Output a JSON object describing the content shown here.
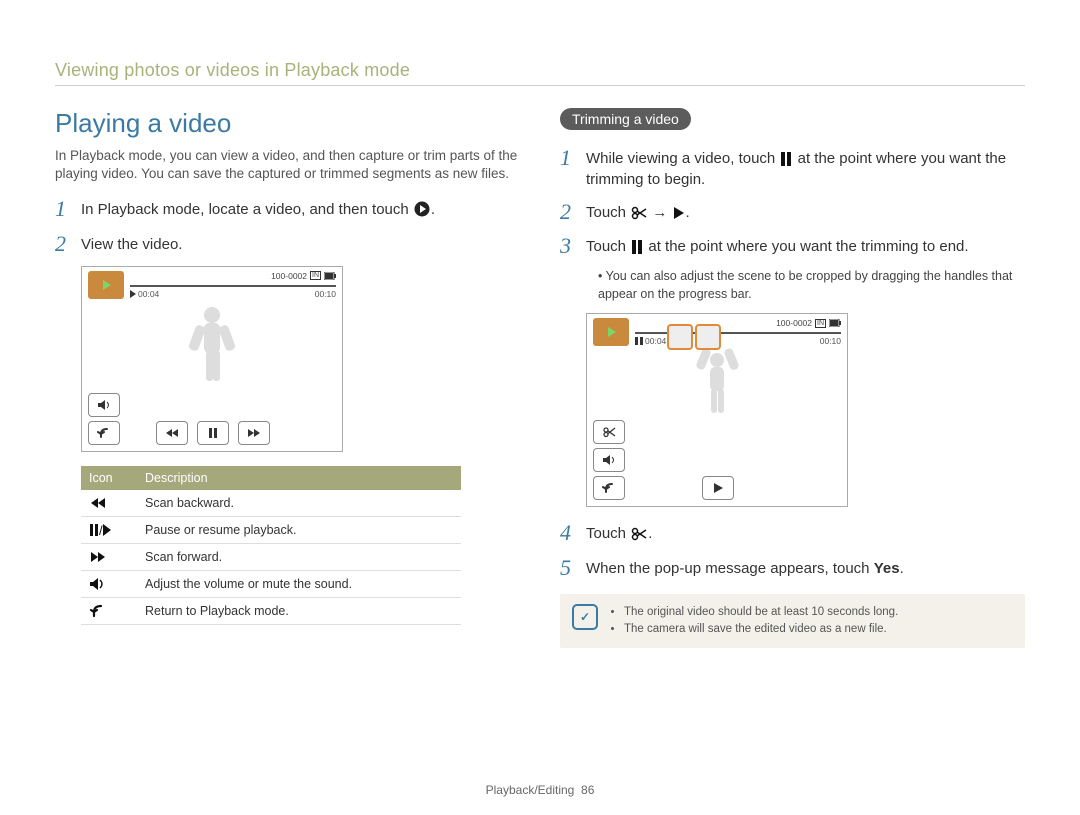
{
  "breadcrumb": "Viewing photos or videos in Playback mode",
  "section_title": "Playing a video",
  "intro": "In Playback mode, you can view a video, and then capture or trim parts of the playing video. You can save the captured or trimmed segments as new files.",
  "left_steps": {
    "s1_a": "In Playback mode, locate a video, and then touch ",
    "s1_b": ".",
    "s2": "View the video."
  },
  "shot1": {
    "elapsed": "00:04",
    "total": "00:10",
    "file_no": "100-0002",
    "mem": "IN"
  },
  "table": {
    "head_icon": "Icon",
    "head_desc": "Description",
    "r1": "Scan backward.",
    "r2": "Pause or resume playback.",
    "r3": "Scan forward.",
    "r4": "Adjust the volume or mute the sound.",
    "r5": "Return to Playback mode."
  },
  "pill": "Trimming a video",
  "right_steps": {
    "s1_a": "While viewing a video, touch ",
    "s1_b": " at the point where you want the trimming to begin.",
    "s2_a": "Touch ",
    "s2_b": " → ",
    "s2_c": ".",
    "s3_a": "Touch ",
    "s3_b": " at the point where you want the trimming to end.",
    "s3_note": "You can also adjust the scene to be cropped by dragging the handles that appear on the progress bar.",
    "s4_a": "Touch ",
    "s4_b": ".",
    "s5_a": "When the pop-up message appears, touch ",
    "s5_yes": "Yes",
    "s5_b": "."
  },
  "shot2": {
    "elapsed": "00:04",
    "total": "00:10",
    "file_no": "100-0002",
    "mem": "IN"
  },
  "note": {
    "item1": "The original video should be at least 10 seconds long.",
    "item2": "The camera will save the edited video as a new file."
  },
  "footer_section": "Playback/Editing",
  "footer_page": "86"
}
